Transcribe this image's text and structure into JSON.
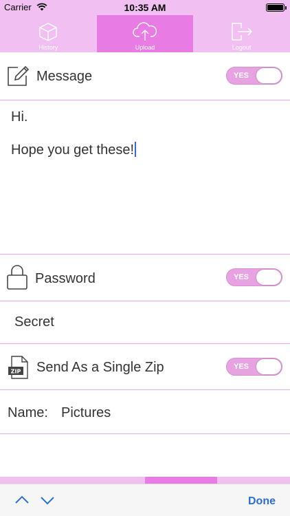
{
  "status": {
    "carrier": "Carrier",
    "time": "10:35 AM"
  },
  "tabs": [
    {
      "label": "History",
      "icon": "cube-icon"
    },
    {
      "label": "Upload",
      "icon": "cloud-upload-icon"
    },
    {
      "label": "Logout",
      "icon": "logout-icon"
    }
  ],
  "active_tab": "Upload",
  "message": {
    "title": "Message",
    "toggle": "YES",
    "lines": [
      "Hi.",
      "Hope you get these!"
    ]
  },
  "password": {
    "title": "Password",
    "toggle": "YES",
    "value": "Secret"
  },
  "zip": {
    "title": "Send As a Single Zip",
    "toggle": "YES",
    "icon_text": "ZIP",
    "name_label": "Name:",
    "name_value": "Pictures"
  },
  "keyboard": {
    "done": "Done"
  },
  "colors": {
    "tab_bg": "#f2bff2",
    "tab_active": "#e97ce4",
    "toggle": "#e7a2e2",
    "divider": "#e6a8e0",
    "done": "#2c6fd6"
  }
}
